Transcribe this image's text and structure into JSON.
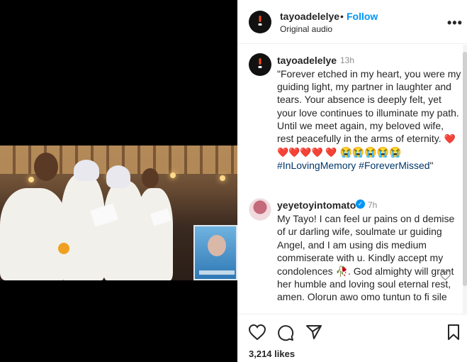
{
  "post": {
    "username": "tayoadelelye",
    "follow_label": "Follow",
    "dot": "•",
    "audio": "Original audio",
    "more": "•••"
  },
  "caption": {
    "username": "tayoadelelye",
    "time": "13h",
    "text": "\"Forever etched in my heart, you were my guiding light, my partner in laughter and tears. Your absence is deeply felt, yet your love continues to illuminate my path. Until we meet again, my beloved wife, rest peacefully in the arms of eternity.",
    "hearts": "❤️❤️❤️❤️❤️ ❤️",
    "crying": "😭😭😭😭😭",
    "hashtag1": "#InLovingMemory",
    "hashtag2": "#ForeverMissed",
    "closing_quote": "\""
  },
  "comment": {
    "username": "yeyetoyintomato",
    "verified": "✓",
    "time": "7h",
    "text": "My Tayo! I can feel ur pains on d demise of ur darling wife, soulmate ur guiding Angel, and I am using dis medium commiserate with u. Kindly accept my condolences 🥀. God almighty will grant her humble and loving soul eternal rest, amen. Olorun awo omo tuntun to fi sile"
  },
  "actions": {
    "likes": "3,214 likes"
  },
  "icons": {
    "like": "heart-outline-icon",
    "comment": "comment-bubble-icon",
    "share": "paper-plane-icon",
    "save": "bookmark-icon",
    "comment_like": "small-heart-icon"
  },
  "colors": {
    "link_blue": "#0095f6",
    "hashtag": "#00376b",
    "muted": "#8e8e8e"
  }
}
